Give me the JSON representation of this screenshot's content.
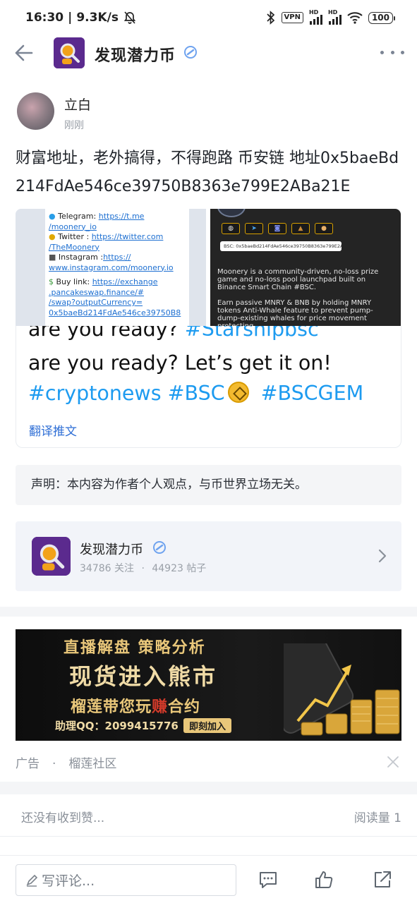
{
  "status": {
    "time": "16:30",
    "speed": "9.3K/s",
    "vpn": "VPN",
    "hd1": "HD",
    "hd2": "HD",
    "battery": "100"
  },
  "header": {
    "title": "发现潜力币"
  },
  "post": {
    "author": "立白",
    "time": "刚刚",
    "text": "财富地址，老外搞得，不得跑路 币安链 地址0x5baeBd214FdAe546ce39750B8363e799E2ABa21E"
  },
  "image_left": {
    "telegram_label": "Telegram: ",
    "telegram_link_1": "https://t.me",
    "telegram_link_2": "/moonery_io",
    "twitter_label": "Twitter : ",
    "twitter_link_1": "https://twitter.com",
    "twitter_link_2": "/TheMoonery",
    "instagram_label": "Instagram :",
    "instagram_link_1": "https://",
    "instagram_link_2": "www.instagram.com/moonery.io",
    "buy_label": "Buy link: ",
    "buy_link_1": "https://exchange",
    "buy_link_2": ".pancakeswap.finance/#",
    "buy_link_3": "/swap?outputCurrency=",
    "buy_link_4": "0x5baeBd214FdAe546ce39750B8"
  },
  "image_right": {
    "address": "BSC: 0x5baeBd214FdAe546ce39750B8363e799E2ABa21E",
    "desc_1": "Moonery is a community-driven, no-loss prize game and no-loss pool launchpad built on Binance Smart Chain #BSC.",
    "desc_2": "Earn passive MNRY & BNB by holding MNRY tokens Anti-Whale feature to prevent pump-dump-existing whales for price movement protecting"
  },
  "tweet": {
    "line1_text": "are you ready? ",
    "line1_tag": "#Starshipbsc",
    "line2": "are you ready? Let’s get it on!",
    "tag1": "#cryptonews",
    "tag2": "#BSC",
    "tag3": "#BSCGEM",
    "translate": "翻译推文"
  },
  "disclaimer": "声明：本内容为作者个人观点，与币世界立场无关。",
  "channel": {
    "name": "发现潜力币",
    "followers": "34786 关注",
    "dot": "·",
    "posts": "44923 帖子"
  },
  "ad": {
    "line1": "直播解盘 策略分析",
    "line2": "现货进入熊市",
    "line3_a": "榴莲带您玩",
    "line3_b": "赚",
    "line3_c": "合约",
    "contact": "助理QQ：2099415776",
    "join": "即刻加入",
    "label": "广告",
    "dot": "·",
    "source": "榴莲社区"
  },
  "likes": {
    "empty": "还没有收到赞...",
    "reads": "阅读量 1"
  },
  "bottom": {
    "comment_placeholder": "写评论..."
  }
}
